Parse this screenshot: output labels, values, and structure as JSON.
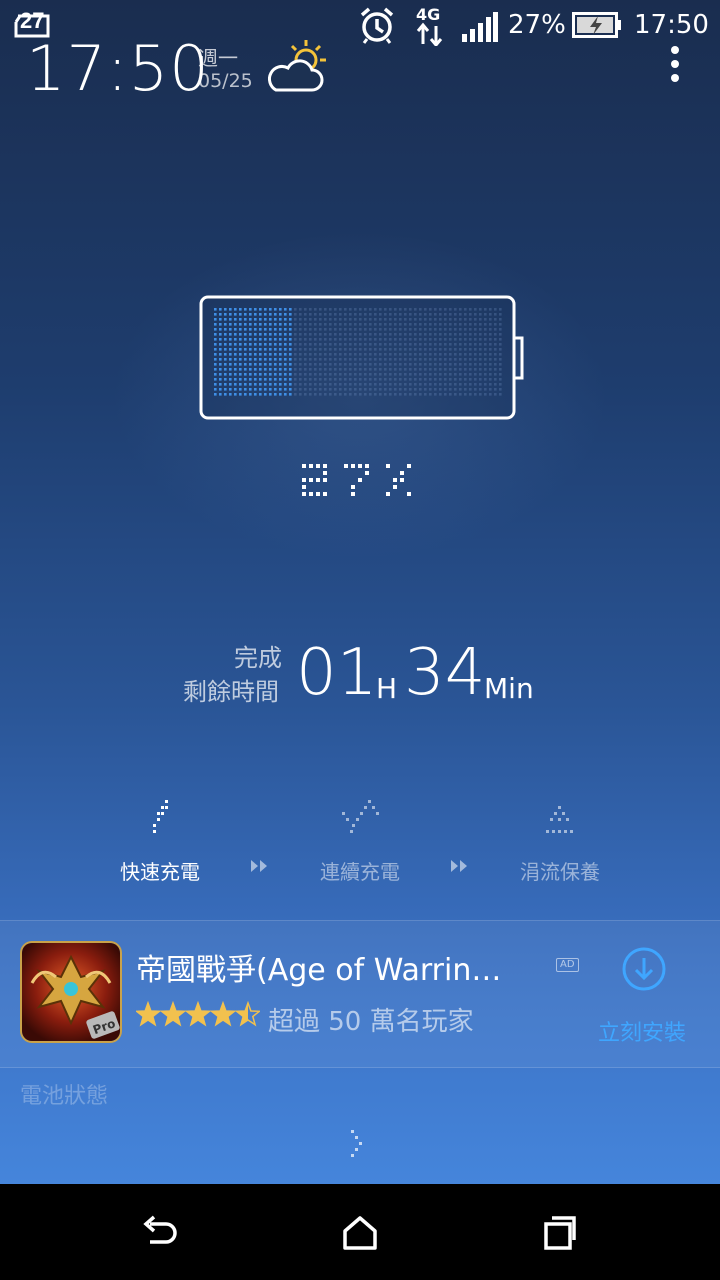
{
  "status_bar": {
    "notification_badge": "27",
    "network": "4G",
    "battery_percent": "27%",
    "time": "17:50",
    "icons": [
      "notification-icon",
      "alarm-icon",
      "4g-data-icon",
      "signal-icon",
      "battery-charging-icon"
    ]
  },
  "header": {
    "clock": "17:50",
    "weekday": "週一",
    "date": "05/25",
    "weather_icon": "partly-sunny-icon",
    "menu_icon": "overflow-menu-icon"
  },
  "battery": {
    "level": 0.27,
    "percent_text": "27%",
    "accent_color": "#3f8fe6"
  },
  "remaining": {
    "status": "完成",
    "label": "剩餘時間",
    "hours": "01",
    "hours_unit": "H",
    "minutes": "34",
    "minutes_unit": "Min"
  },
  "stages": [
    {
      "label": "快速充電",
      "active": true
    },
    {
      "label": "連續充電",
      "active": false
    },
    {
      "label": "涓流保養",
      "active": false
    }
  ],
  "ad": {
    "title": "帝國戰爭(Age of Warrin…",
    "badge": "AD",
    "rating": 4.5,
    "installs": "超過 50 萬名玩家",
    "install_label": "立刻安裝",
    "icon": "game-app-icon"
  },
  "footer": {
    "battery_status": "電池狀態"
  },
  "nav": {
    "buttons": [
      "back-icon",
      "home-icon",
      "recent-apps-icon"
    ]
  }
}
